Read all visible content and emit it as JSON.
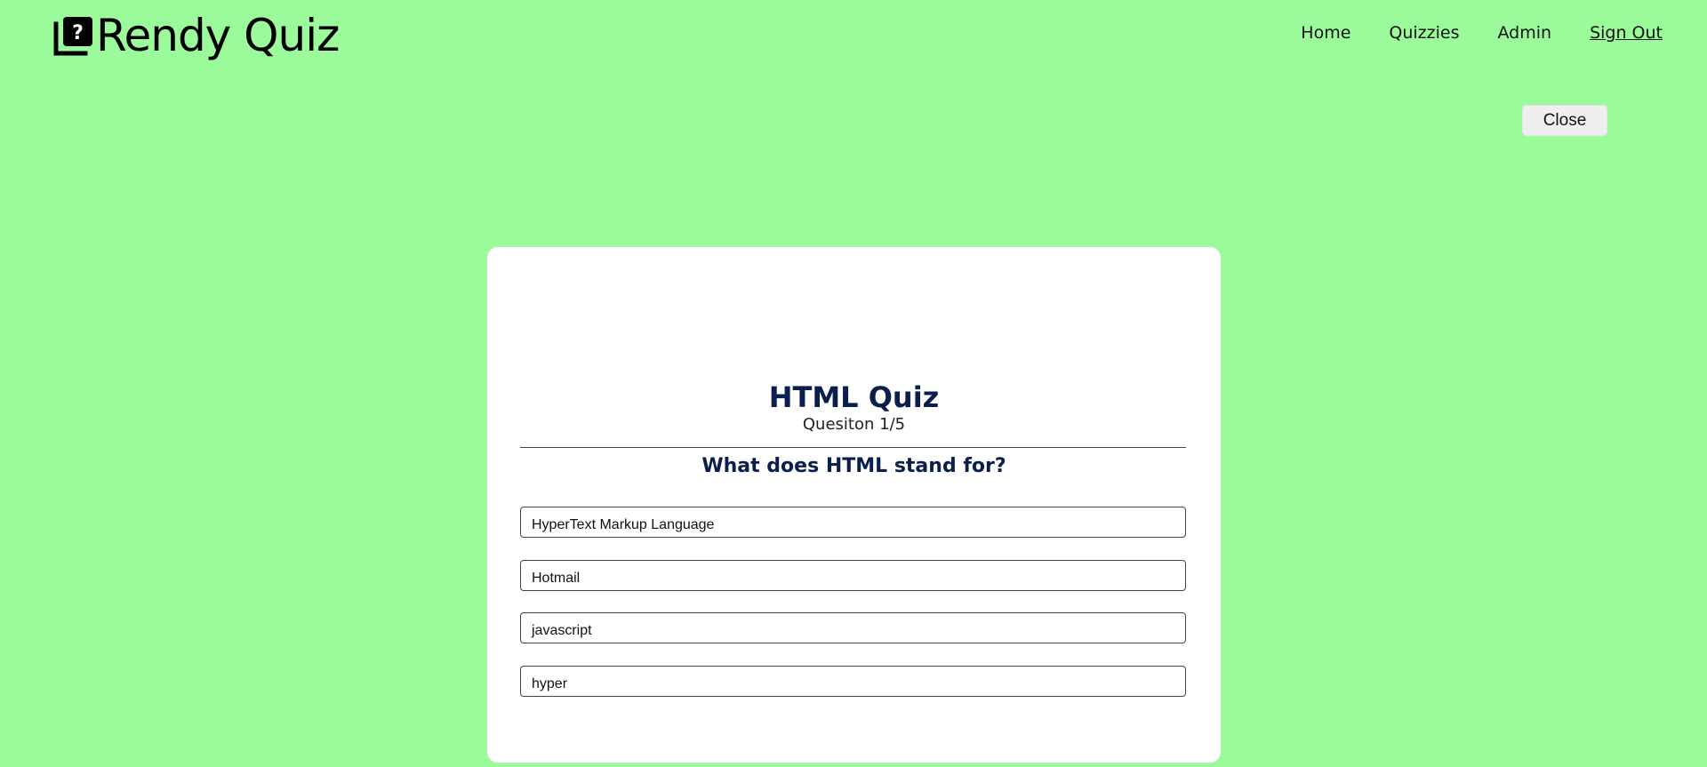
{
  "header": {
    "brand_title": "Rendy Quiz",
    "brand_icon": "quiz-question-icon",
    "nav": [
      {
        "label": "Home"
      },
      {
        "label": "Quizzies"
      },
      {
        "label": "Admin"
      },
      {
        "label": "Sign Out"
      }
    ]
  },
  "close_button": {
    "label": "Close"
  },
  "quiz": {
    "title": "HTML Quiz",
    "progress": "Quesiton 1/5",
    "question": "What does HTML stand for?",
    "answers": [
      {
        "label": "HyperText Markup Language"
      },
      {
        "label": "Hotmail"
      },
      {
        "label": "javascript"
      },
      {
        "label": "hyper"
      }
    ]
  },
  "colors": {
    "background": "#9bfb9b",
    "card": "#ffffff",
    "heading": "#0b1f4d"
  }
}
